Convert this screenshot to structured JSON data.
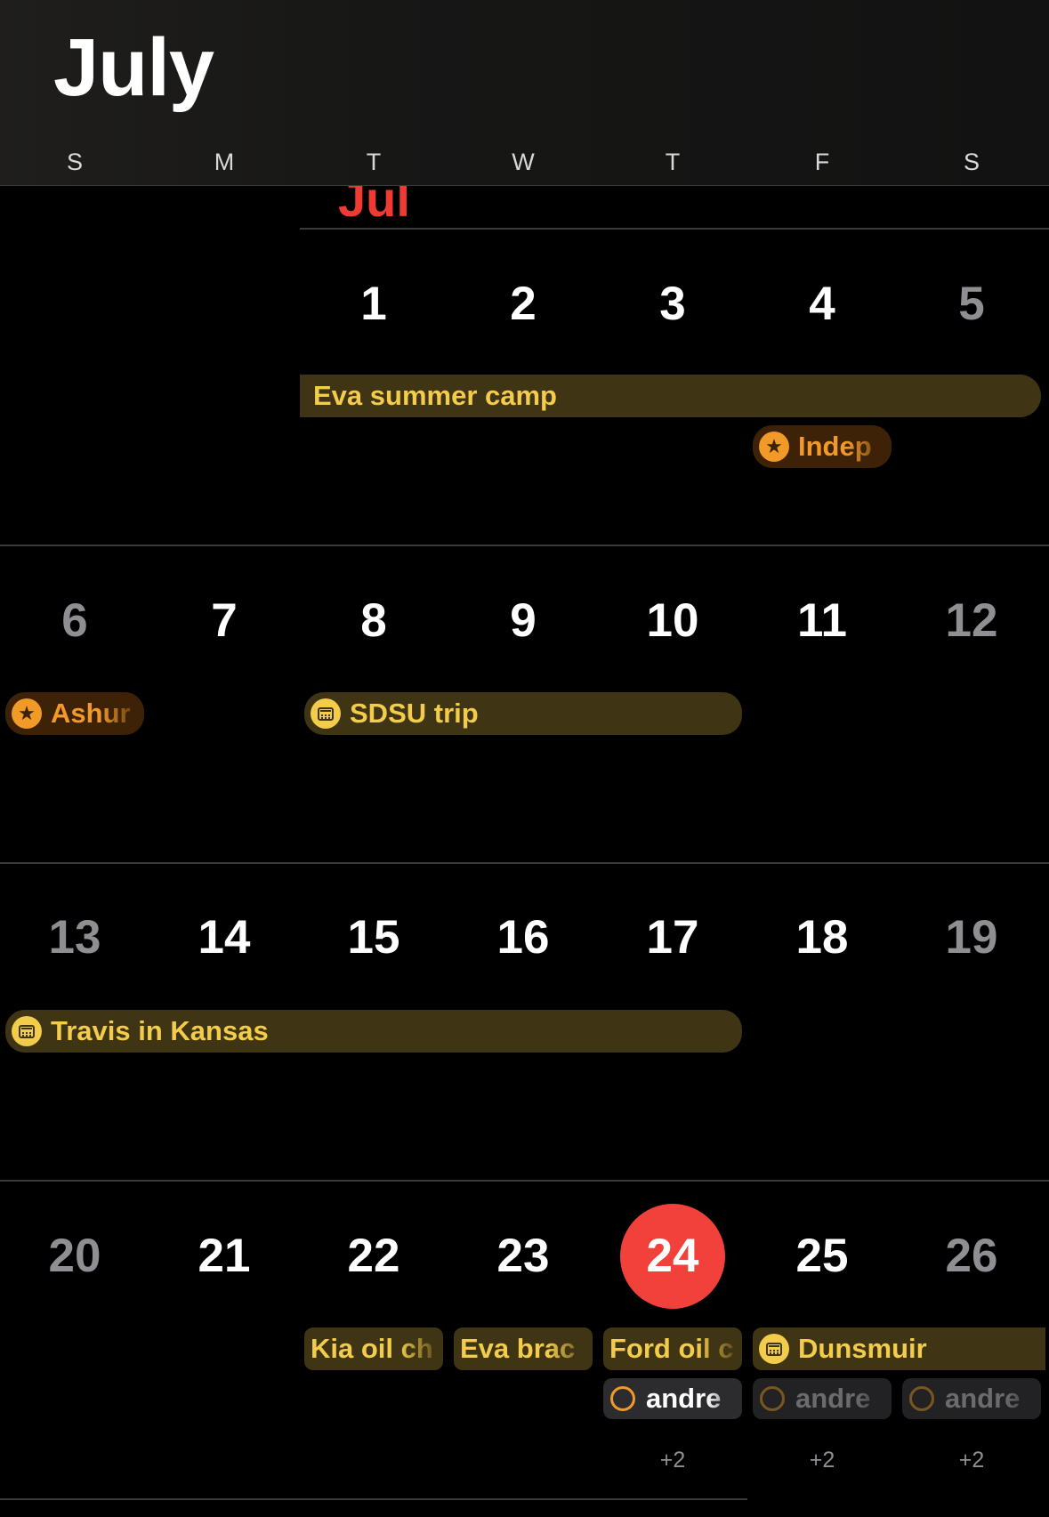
{
  "header": {
    "title": "July",
    "weekdays": [
      "S",
      "M",
      "T",
      "W",
      "T",
      "F",
      "S"
    ]
  },
  "calendar": {
    "month_marker": "Jul",
    "weeks": [
      {
        "days": [
          "",
          "",
          "1",
          "2",
          "3",
          "4",
          "5"
        ]
      },
      {
        "days": [
          "6",
          "7",
          "8",
          "9",
          "10",
          "11",
          "12"
        ]
      },
      {
        "days": [
          "13",
          "14",
          "15",
          "16",
          "17",
          "18",
          "19"
        ]
      },
      {
        "days": [
          "20",
          "21",
          "22",
          "23",
          "24",
          "25",
          "26"
        ]
      }
    ],
    "today": "24",
    "events": {
      "eva_summer_camp": "Eva summer camp",
      "independence": "Indep",
      "ashura": "Ashur",
      "sdsu_trip": "SDSU trip",
      "travis": "Travis in Kansas",
      "kia": "Kia oil ch",
      "eva_braces": "Eva brac",
      "ford": "Ford oil c",
      "dunsmuir": "Dunsmuir"
    },
    "reminders": {
      "thu": "andre",
      "fri": "andre",
      "sat": "andre"
    },
    "more": {
      "thu": "+2",
      "fri": "+2",
      "sat": "+2"
    }
  },
  "colors": {
    "accent_red": "#f2403a",
    "event_yellow": "#f2cc4a",
    "event_orange": "#f29a28",
    "background": "#000000"
  }
}
